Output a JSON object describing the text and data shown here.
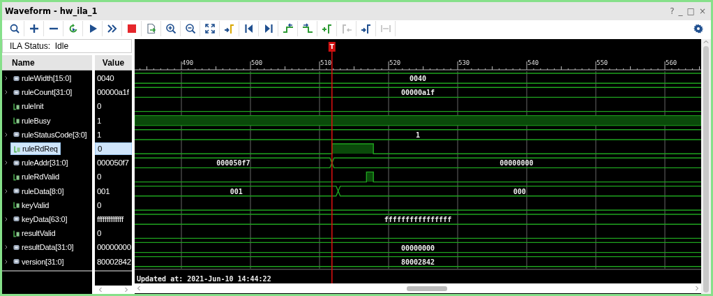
{
  "window": {
    "title": "Waveform - hw_ila_1",
    "controls": [
      "?",
      "_",
      "□",
      "×"
    ]
  },
  "toolbar": [
    {
      "kind": "search",
      "disabled": false
    },
    {
      "kind": "plus",
      "disabled": false
    },
    {
      "kind": "minus",
      "disabled": false
    },
    {
      "kind": "rerun",
      "disabled": false
    },
    {
      "kind": "run",
      "disabled": false
    },
    {
      "kind": "run-now",
      "disabled": false
    },
    {
      "kind": "stop",
      "disabled": false
    },
    {
      "kind": "export",
      "disabled": false
    },
    {
      "kind": "zoom-in",
      "disabled": false
    },
    {
      "kind": "zoom-out",
      "disabled": false
    },
    {
      "kind": "zoom-fit",
      "disabled": false
    },
    {
      "kind": "goto-cursor",
      "disabled": false
    },
    {
      "kind": "goto-start",
      "disabled": false
    },
    {
      "kind": "goto-end",
      "disabled": false
    },
    {
      "kind": "prev-edge",
      "disabled": false
    },
    {
      "kind": "next-edge",
      "disabled": false
    },
    {
      "kind": "add-marker",
      "disabled": false
    },
    {
      "kind": "prev-marker",
      "disabled": true
    },
    {
      "kind": "next-marker",
      "disabled": false
    },
    {
      "kind": "swap-markers",
      "disabled": true
    }
  ],
  "status": {
    "label": "ILA Status:",
    "value": "Idle"
  },
  "columns": [
    "Name",
    "Value"
  ],
  "signals": [
    {
      "name": "ruleWidth[15:0]",
      "kind": "bus",
      "expanded": false,
      "value": "0040",
      "selected": false,
      "wave_labels": [
        "0040"
      ]
    },
    {
      "name": "ruleCount[31:0]",
      "kind": "bus",
      "expanded": false,
      "value": "00000a1f",
      "selected": false,
      "wave_labels": [
        "00000a1f"
      ]
    },
    {
      "name": "ruleInit",
      "kind": "bit",
      "value": "0",
      "selected": false
    },
    {
      "name": "ruleBusy",
      "kind": "bit",
      "value": "1",
      "selected": false
    },
    {
      "name": "ruleStatusCode[3:0]",
      "kind": "bus",
      "expanded": false,
      "value": "1",
      "selected": false,
      "wave_labels": [
        "1"
      ]
    },
    {
      "name": "ruleRdReq",
      "kind": "bit",
      "value": "0",
      "selected": true
    },
    {
      "name": "ruleAddr[31:0]",
      "kind": "bus",
      "expanded": false,
      "value": "000050f7",
      "selected": false,
      "wave_labels": [
        "000050f7",
        "00000000"
      ]
    },
    {
      "name": "ruleRdValid",
      "kind": "bit",
      "value": "0",
      "selected": false
    },
    {
      "name": "ruleData[8:0]",
      "kind": "bus",
      "expanded": false,
      "value": "001",
      "selected": false,
      "wave_labels": [
        "001",
        "000"
      ]
    },
    {
      "name": "keyValid",
      "kind": "bit",
      "value": "0",
      "selected": false
    },
    {
      "name": "keyData[63:0]",
      "kind": "bus",
      "expanded": false,
      "value": "ffffffffffffff",
      "selected": false,
      "wave_labels": [
        "ffffffffffffffff"
      ]
    },
    {
      "name": "resultValid",
      "kind": "bit",
      "value": "0",
      "selected": false
    },
    {
      "name": "resultData[31:0]",
      "kind": "bus",
      "expanded": false,
      "value": "00000000",
      "selected": false,
      "wave_labels": [
        "00000000"
      ]
    },
    {
      "name": "version[31:0]",
      "kind": "bus",
      "expanded": false,
      "value": "80002842",
      "selected": false,
      "wave_labels": [
        "80002842"
      ]
    }
  ],
  "ruler_labels": [
    "490",
    "500",
    "510",
    "520",
    "530",
    "540",
    "550",
    "560"
  ],
  "cursor": {
    "label": "T"
  },
  "footer": "Updated at: 2021-Jun-10 14:44:22"
}
